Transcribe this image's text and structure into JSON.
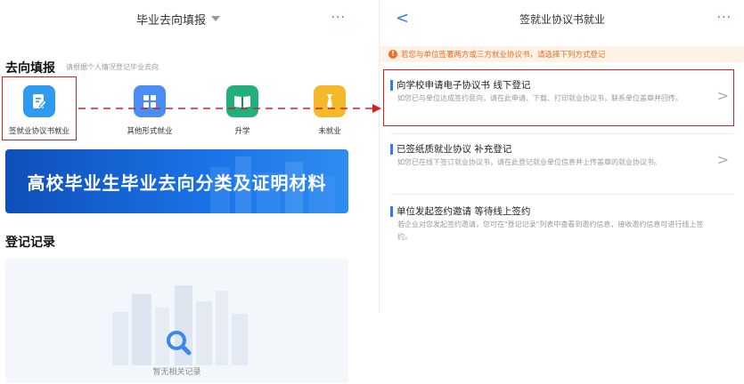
{
  "left": {
    "header_title": "毕业去向填报",
    "more": "···",
    "section_title": "去向填报",
    "section_hint": "请根据个人情况登记毕业去向",
    "icons": [
      {
        "label": "签就业协议书就业",
        "color": "#2f9bf0",
        "icon": "edit-document-icon"
      },
      {
        "label": "其他形式就业",
        "color": "#4a8df5",
        "icon": "grid-icon"
      },
      {
        "label": "升学",
        "color": "#22b07a",
        "icon": "book-icon"
      },
      {
        "label": "未就业",
        "color": "#f5b82a",
        "icon": "tie-icon"
      }
    ],
    "banner_text": "高校毕业生毕业去向分类及证明材料",
    "records_title": "登记记录",
    "empty_text": "暂无相关记录"
  },
  "right": {
    "back": "<",
    "header_title": "签就业协议书就业",
    "more": "···",
    "notice": "若您与单位签署两方或三方就业协议书，请选择下列方式登记",
    "options": [
      {
        "title": "向学校申请电子协议书 线下登记",
        "desc": "如您已与单位达成签约意向，请在此申请、下载、打印就业协议书，联系单位盖章并回传。",
        "chevron": ">"
      },
      {
        "title": "已签纸质就业协议 补充登记",
        "desc": "如您已在线下签订就业协议书，请在此登记就业单位信息并上传盖章的就业协议书。",
        "chevron": ">"
      },
      {
        "title": "单位发起签约邀请 等待线上签约",
        "desc": "若企业对您发起签约邀请，您可在\"登记记录\"列表中查看到邀约信息，接收邀约信息可进行线上签约。",
        "chevron": ""
      }
    ]
  },
  "colors": {
    "accent": "#3478f6",
    "highlight": "#d42020",
    "notice": "#f06a1a"
  }
}
